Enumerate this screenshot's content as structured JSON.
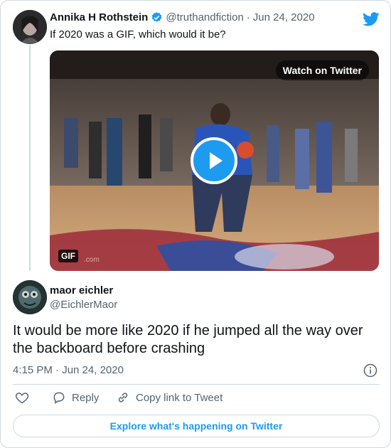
{
  "original_tweet": {
    "author_name": "Annika H Rothstein",
    "verified": true,
    "handle": "@truthandfiction",
    "separator": "·",
    "date": "Jun 24, 2020",
    "text": "If 2020 was a GIF, which would it be?",
    "media": {
      "watch_label": "Watch on Twitter",
      "gif_label": "GIF",
      "watermark": ".com"
    }
  },
  "reply_tweet": {
    "author_name": "maor eichler",
    "handle": "@EichlerMaor",
    "text": "It would be more like 2020 if he jumped all the way over the backboard before crashing",
    "timestamp": "4:15 PM · Jun 24, 2020"
  },
  "actions": {
    "reply_label": "Reply",
    "copy_link_label": "Copy link to Tweet"
  },
  "footer": {
    "explore_label": "Explore what's happening on Twitter"
  },
  "icons": {
    "brand": "twitter-bird-icon",
    "verified": "verified-badge-icon",
    "info": "info-icon",
    "like": "heart-icon",
    "reply": "reply-icon",
    "copy": "link-icon",
    "play": "play-icon"
  },
  "colors": {
    "accent": "#1d9bf0",
    "text": "#0f1419",
    "muted": "#536471",
    "border": "#cfd9de"
  }
}
